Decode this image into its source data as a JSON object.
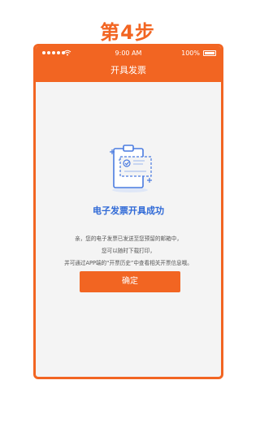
{
  "step_heading": "第4步",
  "status_bar": {
    "time": "9:00 AM",
    "battery": "100%"
  },
  "nav": {
    "title": "开具发票"
  },
  "success": {
    "title": "电子发票开具成功",
    "message_lines": [
      "亲，您的电子发票已发送至您预留的邮箱中，",
      "您可以随时下载打印，",
      "并可通过APP端的“开票历史”中查看相关开票信息哦。"
    ]
  },
  "confirm_button": {
    "label": "确定"
  },
  "colors": {
    "accent": "#f26522",
    "success_title": "#2f69d6",
    "icon_stroke": "#4a7be0",
    "background": "#f4f4f4"
  },
  "icons": [
    "signal-icon",
    "wifi-icon",
    "battery-icon",
    "invoice-success-icon"
  ]
}
